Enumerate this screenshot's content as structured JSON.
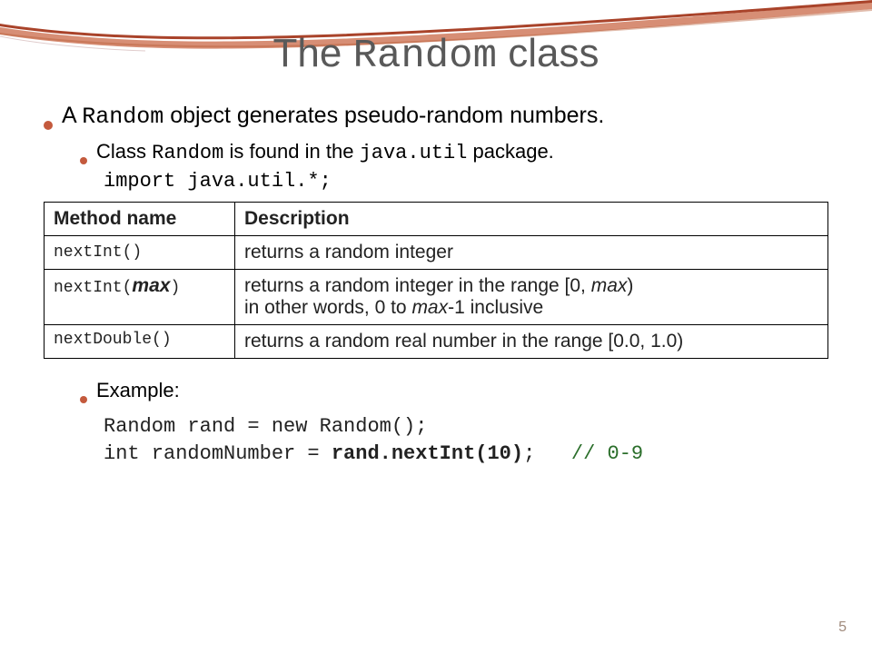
{
  "title": {
    "pre": "The ",
    "mono": "Random",
    "post": " class"
  },
  "bullet1": {
    "pre": "A ",
    "mono": "Random",
    "post": " object generates pseudo-random numbers."
  },
  "bullet2": {
    "pre": "Class ",
    "mono1": "Random",
    "mid": " is found in the ",
    "mono2": "java.util",
    "post": " package."
  },
  "import_line": "import java.util.*;",
  "table": {
    "h1": "Method name",
    "h2": "Description",
    "rows": [
      {
        "m_pre": "nextInt()",
        "m_ital": "",
        "m_post": "",
        "d": "returns a random integer",
        "d_line2_a": "",
        "d_line2_i": "",
        "d_line2_b": ""
      },
      {
        "m_pre": "nextInt(",
        "m_ital": "max",
        "m_post": ")",
        "d": "returns a random integer in the range [0, ",
        "d_i": "max",
        "d_b": ")",
        "d_line2_a": "in other words, 0 to ",
        "d_line2_i": "max",
        "d_line2_b": "-1 inclusive"
      },
      {
        "m_pre": "nextDouble()",
        "m_ital": "",
        "m_post": "",
        "d": "returns a random real number in the range [0.0, 1.0)",
        "d_line2_a": "",
        "d_line2_i": "",
        "d_line2_b": ""
      }
    ]
  },
  "example_label": "Example:",
  "example_code": {
    "l1": "Random rand = new Random();",
    "l2a": "int randomNumber = ",
    "l2b": "rand.nextInt(10)",
    "l2c": ";",
    "l2gap": "   ",
    "l2d": "// 0-9"
  },
  "page_number": "5"
}
